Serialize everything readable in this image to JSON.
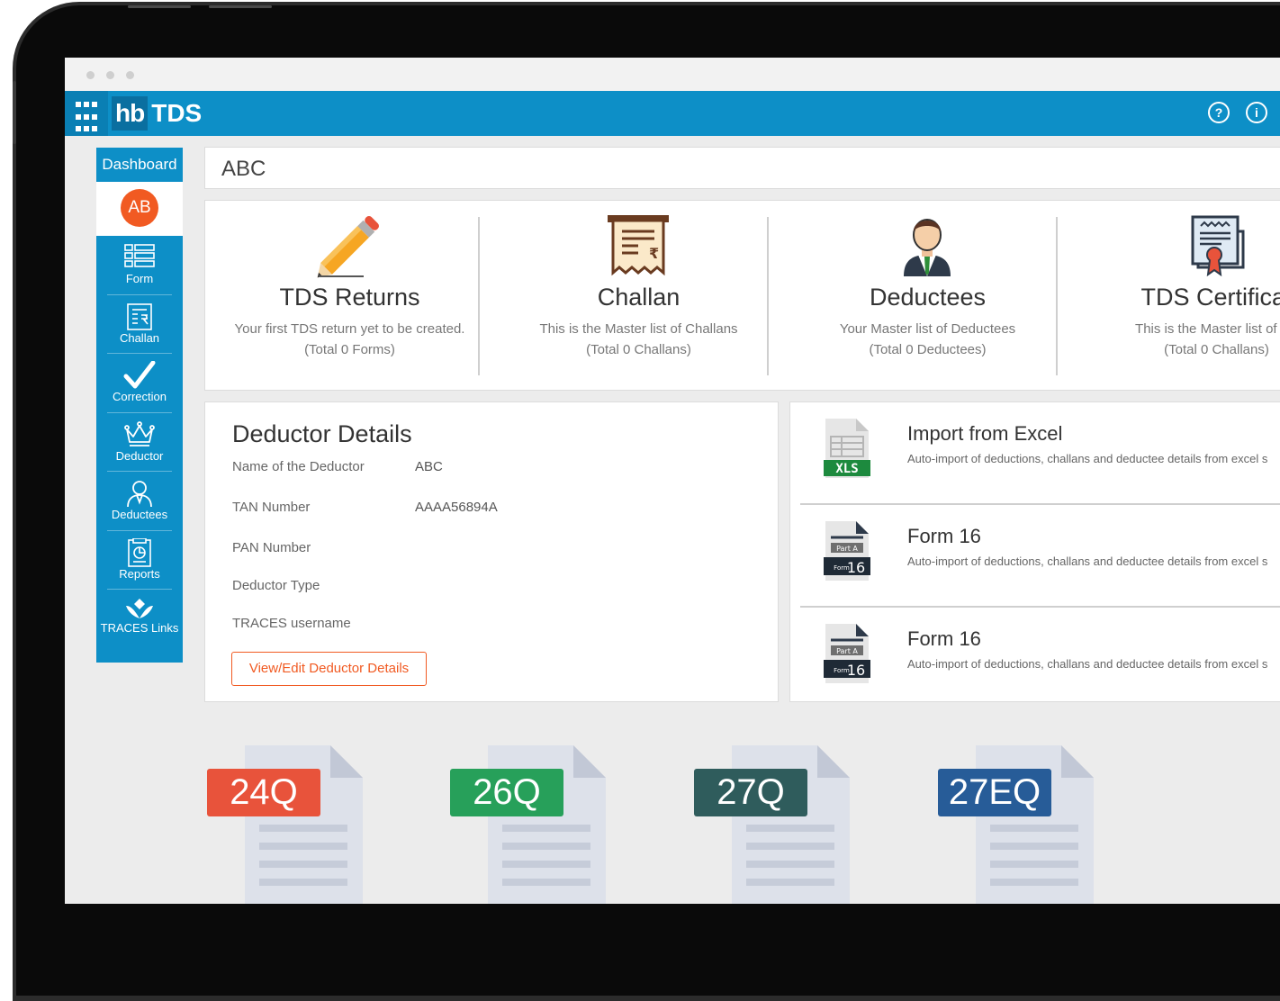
{
  "app": {
    "logo_short": "hb",
    "logo_name": "TDS",
    "help_icon": "help-circle-icon",
    "info_icon": "info-circle-icon"
  },
  "sidebar": {
    "header": "Dashboard",
    "avatar_initials": "AB",
    "items": [
      {
        "label": "Form",
        "icon": "form-list-icon"
      },
      {
        "label": "Challan",
        "icon": "challan-receipt-icon"
      },
      {
        "label": "Correction",
        "icon": "checkmark-icon"
      },
      {
        "label": "Deductor",
        "icon": "crown-icon"
      },
      {
        "label": "Deductees",
        "icon": "person-icon"
      },
      {
        "label": "Reports",
        "icon": "reports-icon"
      },
      {
        "label": "TRACES Links",
        "icon": "traces-logo-icon"
      }
    ]
  },
  "company": {
    "name": "ABC"
  },
  "cards": [
    {
      "title": "TDS Returns",
      "line1": "Your first TDS return yet to be created.",
      "line2": "(Total 0 Forms)",
      "icon": "pencil-icon"
    },
    {
      "title": "Challan",
      "line1": "This is the Master list of Challans",
      "line2": "(Total 0 Challans)",
      "icon": "receipt-icon"
    },
    {
      "title": "Deductees",
      "line1": "Your Master list of Deductees",
      "line2": "(Total 0 Deductees)",
      "icon": "person-tie-icon"
    },
    {
      "title": "TDS Certificat",
      "line1": "This is the Master list of Ch",
      "line2": "(Total 0 Challans)",
      "icon": "certificate-icon"
    }
  ],
  "deductor": {
    "heading": "Deductor Details",
    "rows": [
      {
        "label": "Name of the Deductor",
        "value": "ABC"
      },
      {
        "label": "TAN Number",
        "value": "AAAA56894A"
      },
      {
        "label": "PAN Number",
        "value": ""
      },
      {
        "label": "Deductor Type",
        "value": ""
      },
      {
        "label": "TRACES username",
        "value": ""
      }
    ],
    "edit_button": "View/Edit Deductor Details"
  },
  "imports": [
    {
      "title": "Import from Excel",
      "desc": "Auto-import of deductions, challans and deductee details from excel s",
      "icon": "xls-file-icon",
      "badge": "XLS"
    },
    {
      "title": "Form 16",
      "desc": "Auto-import of deductions, challans and deductee details from excel s",
      "icon": "form16-file-icon",
      "part": "Part A",
      "form_small": "Form",
      "form_num": "16"
    },
    {
      "title": "Form 16",
      "desc": "Auto-import of deductions, challans and deductee details from excel s",
      "icon": "form16-file-icon",
      "part": "Part A",
      "form_small": "Form",
      "form_num": "16"
    }
  ],
  "forms": [
    {
      "label": "24Q",
      "color": "#e8533b"
    },
    {
      "label": "26Q",
      "color": "#27a05a"
    },
    {
      "label": "27Q",
      "color": "#2f5c5c"
    },
    {
      "label": "27EQ",
      "color": "#275c98"
    }
  ]
}
